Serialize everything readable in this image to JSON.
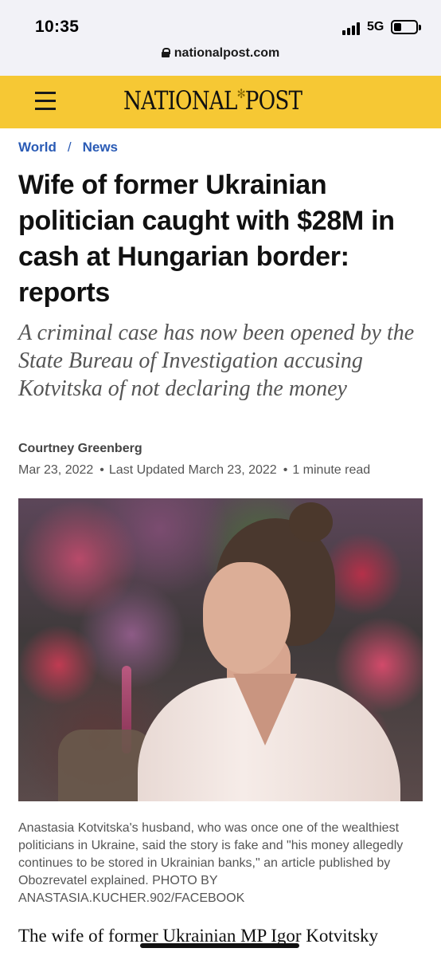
{
  "status_bar": {
    "time": "10:35",
    "network": "5G",
    "url": "nationalpost.com"
  },
  "header": {
    "logo_left": "NATIONAL",
    "logo_right": "POST",
    "brand_color": "#f6c834"
  },
  "breadcrumb": {
    "items": [
      "World",
      "News"
    ],
    "separator": "/"
  },
  "article": {
    "headline": "Wife of former Ukrainian politician caught with $28M in cash at Hungarian border: reports",
    "subheadline": "A criminal case has now been opened by the State Bureau of Investigation accusing Kotvitska of not declaring the money",
    "author": "Courtney Greenberg",
    "published": "Mar 23, 2022",
    "updated": "Last Updated March 23, 2022",
    "read_time": "1 minute read",
    "photo_caption": "Anastasia Kotvitska's husband, who was once one of the wealthiest politicians in Ukraine, said the story is fake and \"his money allegedly continues to be stored in Ukrainian banks,\" an article published by Obozrevatel explained. PHOTO BY ANASTASIA.KUCHER.902/FACEBOOK",
    "body_first_line": "The wife of former Ukrainian MP Igor Kotvitsky"
  }
}
